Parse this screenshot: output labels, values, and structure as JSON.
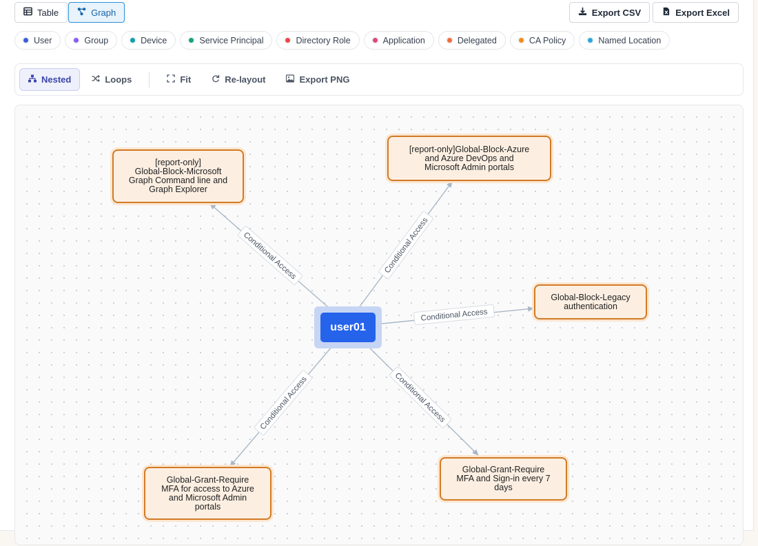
{
  "view_toggle": {
    "table_label": "Table",
    "graph_label": "Graph"
  },
  "export": {
    "csv_label": "Export CSV",
    "excel_label": "Export Excel"
  },
  "legend": [
    {
      "label": "User",
      "color": "#3b5bdb"
    },
    {
      "label": "Group",
      "color": "#8b5cf6"
    },
    {
      "label": "Device",
      "color": "#0e9fb0"
    },
    {
      "label": "Service Principal",
      "color": "#10a37f"
    },
    {
      "label": "Directory Role",
      "color": "#ef4444"
    },
    {
      "label": "Application",
      "color": "#e0457b"
    },
    {
      "label": "Delegated",
      "color": "#f26b3a"
    },
    {
      "label": "CA Policy",
      "color": "#f08c1c"
    },
    {
      "label": "Named Location",
      "color": "#29a8e0"
    }
  ],
  "graph_toolbar": {
    "nested_label": "Nested",
    "loops_label": "Loops",
    "fit_label": "Fit",
    "relayout_label": "Re-layout",
    "export_png_label": "Export PNG"
  },
  "graph": {
    "center_node": "user01",
    "edge_label": "Conditional Access",
    "policies": {
      "graph_cli": [
        "[report-only]",
        "Global-Block-Microsoft",
        "Graph Command line and",
        "Graph Explorer"
      ],
      "azure_devops": [
        "[report-only]Global-Block-Azure",
        "and Azure DevOps and",
        "Microsoft Admin portals"
      ],
      "legacy_auth": [
        "Global-Block-Legacy",
        "authentication"
      ],
      "mfa_azure": [
        "Global-Grant-Require",
        "MFA for access to Azure",
        "and Microsoft Admin",
        "portals"
      ],
      "mfa_signin": [
        "Global-Grant-Require",
        "MFA and Sign-in every 7",
        "days"
      ]
    }
  }
}
